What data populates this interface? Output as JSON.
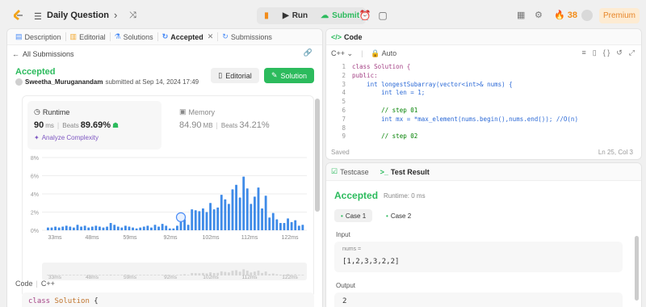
{
  "topbar": {
    "problem_title": "Daily Question",
    "run_label": "Run",
    "submit_label": "Submit",
    "streak_count": "38",
    "premium_label": "Premium"
  },
  "left": {
    "tabs": [
      {
        "label": "Description"
      },
      {
        "label": "Editorial"
      },
      {
        "label": "Solutions"
      },
      {
        "label": "Accepted"
      },
      {
        "label": "Submissions"
      }
    ],
    "all_submissions": "All Submissions",
    "status": "Accepted",
    "author": "Sweetha_Muruganandam",
    "submitted_text": "submitted at Sep 14, 2024 17:49",
    "editorial_button": "Editorial",
    "solution_button": "Solution",
    "runtime": {
      "label": "Runtime",
      "value": "90",
      "unit": "ms",
      "beats_label": "Beats",
      "beats_pct": "89.69%",
      "analyze": "Analyze Complexity"
    },
    "memory": {
      "label": "Memory",
      "value": "84.90",
      "unit": "MB",
      "beats_label": "Beats",
      "beats_pct": "34.21%"
    },
    "code_label": "Code",
    "code_lang": "C++",
    "code_snippet_kw": "class",
    "code_snippet_name": "Solution",
    "code_snippet_brace": "{"
  },
  "chart_data": {
    "type": "bar",
    "ylabel_ticks": [
      "0%",
      "2%",
      "4%",
      "6%",
      "8%"
    ],
    "ylim": [
      0,
      8
    ],
    "x_ticks": [
      "33ms",
      "48ms",
      "59ms",
      "92ms",
      "102ms",
      "112ms",
      "122ms"
    ],
    "values": [
      0.3,
      0.3,
      0.4,
      0.3,
      0.4,
      0.5,
      0.4,
      0.3,
      0.6,
      0.4,
      0.5,
      0.3,
      0.4,
      0.5,
      0.4,
      0.3,
      0.4,
      0.8,
      0.6,
      0.4,
      0.3,
      0.5,
      0.4,
      0.3,
      0.2,
      0.3,
      0.4,
      0.5,
      0.3,
      0.6,
      0.4,
      0.7,
      0.5,
      0.2,
      0.2,
      0.5,
      0.9,
      1.2,
      0.6,
      2.3,
      2.2,
      2.1,
      2.4,
      2.0,
      3.0,
      2.3,
      2.5,
      3.9,
      3.4,
      2.9,
      4.5,
      5.0,
      3.6,
      5.9,
      4.6,
      2.9,
      3.7,
      4.7,
      2.4,
      3.8,
      1.4,
      1.9,
      1.2,
      0.8,
      0.8,
      1.3,
      0.9,
      1.1,
      0.5,
      0.6
    ],
    "highlight_index": 36,
    "grid": true
  },
  "editor": {
    "title": "Code",
    "language": "C++",
    "mode": "Auto",
    "saved": "Saved",
    "cursor": "Ln 25, Col 3",
    "lines": [
      {
        "n": "1",
        "text": "class Solution {"
      },
      {
        "n": "2",
        "text": "public:"
      },
      {
        "n": "3",
        "text": "    int longestSubarray(vector<int>& nums) {"
      },
      {
        "n": "4",
        "text": "        int len = 1;"
      },
      {
        "n": "5",
        "text": ""
      },
      {
        "n": "6",
        "text": "        // step 01"
      },
      {
        "n": "7",
        "text": "        int mx = *max_element(nums.begin(),nums.end()); //O(n)"
      },
      {
        "n": "8",
        "text": ""
      },
      {
        "n": "9",
        "text": "        // step 02"
      }
    ]
  },
  "result": {
    "tab_testcase": "Testcase",
    "tab_result": "Test Result",
    "status": "Accepted",
    "runtime": "Runtime: 0 ms",
    "case1": "Case 1",
    "case2": "Case 2",
    "input_label": "Input",
    "input_name": "nums =",
    "input_value": "[1,2,3,3,2,2]",
    "output_label": "Output",
    "output_value": "2"
  }
}
